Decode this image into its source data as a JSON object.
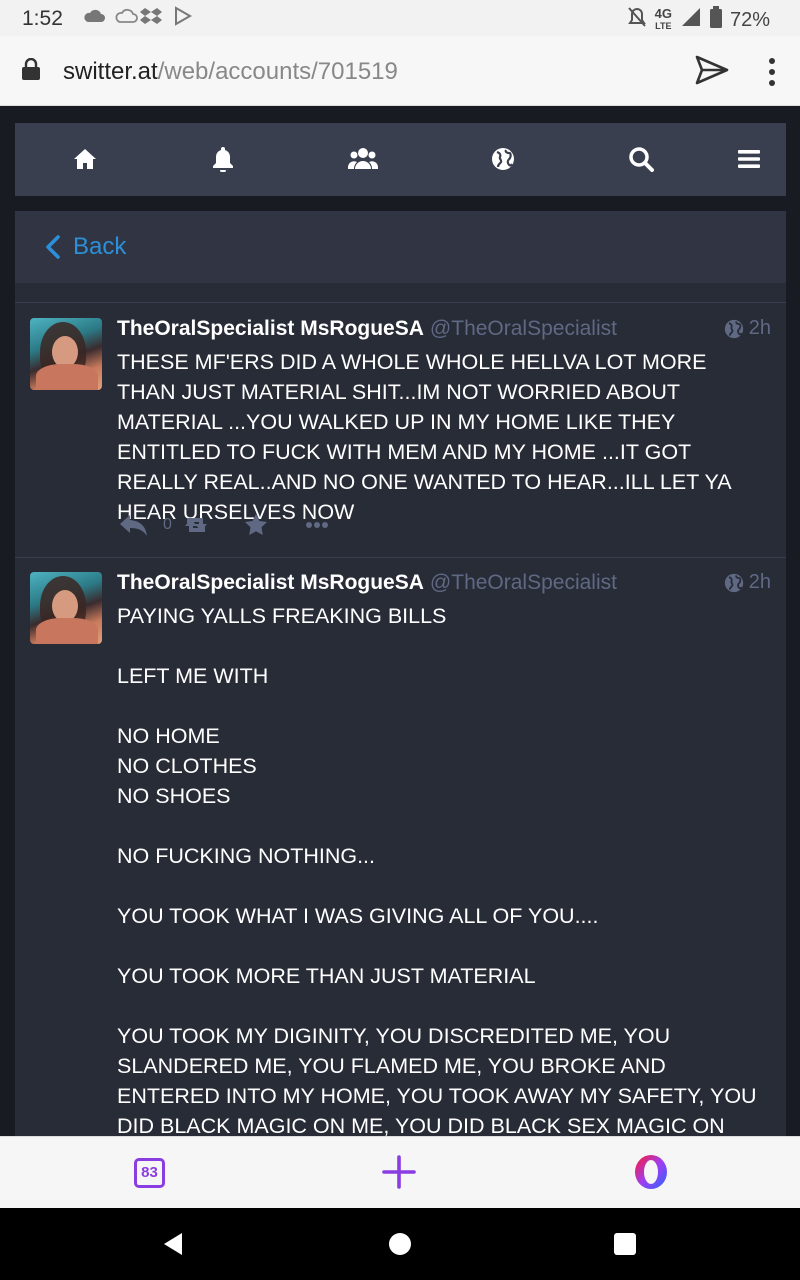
{
  "status_bar": {
    "time": "1:52",
    "network": "4G",
    "network_sub": "LTE",
    "battery": "72%"
  },
  "browser": {
    "url_domain": "switter.at",
    "url_path": "/web/accounts/701519"
  },
  "nav": {
    "icons": [
      "home-icon",
      "bell-icon",
      "people-icon",
      "globe-icon",
      "search-icon",
      "menu-icon"
    ]
  },
  "column": {
    "back_label": "Back"
  },
  "statuses": [
    {
      "display_name": "TheOralSpecialist MsRogueSA",
      "acct": "@TheOralSpecialist",
      "time": "2h",
      "content": "THESE MF'ERS DID A WHOLE WHOLE HELLVA LOT MORE THAN JUST MATERIAL SHIT...IM NOT WORRIED ABOUT MATERIAL ...YOU WALKED UP IN MY HOME LIKE THEY ENTITLED TO FUCK WITH MEM AND MY HOME ...IT GOT REALLY REAL..AND NO ONE WANTED TO HEAR...ILL LET YA HEAR URSELVES NOW",
      "reply_count": "0"
    },
    {
      "display_name": "TheOralSpecialist MsRogueSA",
      "acct": "@TheOralSpecialist",
      "time": "2h",
      "content": "PAYING YALLS FREAKING BILLS\n\nLEFT ME WITH\n\nNO HOME\nNO CLOTHES\nNO SHOES\n\nNO FUCKING NOTHING...\n\nYOU TOOK WHAT I WAS GIVING ALL OF YOU....\n\nYOU TOOK MORE THAN JUST MATERIAL\n\nYOU TOOK MY DIGINITY, YOU DISCREDITED ME, YOU SLANDERED ME, YOU FLAMED ME, YOU BROKE AND ENTERED INTO MY HOME, YOU TOOK AWAY MY SAFETY, YOU DID BLACK MAGIC ON ME, YOU DID BLACK SEX MAGIC ON ME,"
    }
  ],
  "opera_bar": {
    "tab_count": "83"
  }
}
